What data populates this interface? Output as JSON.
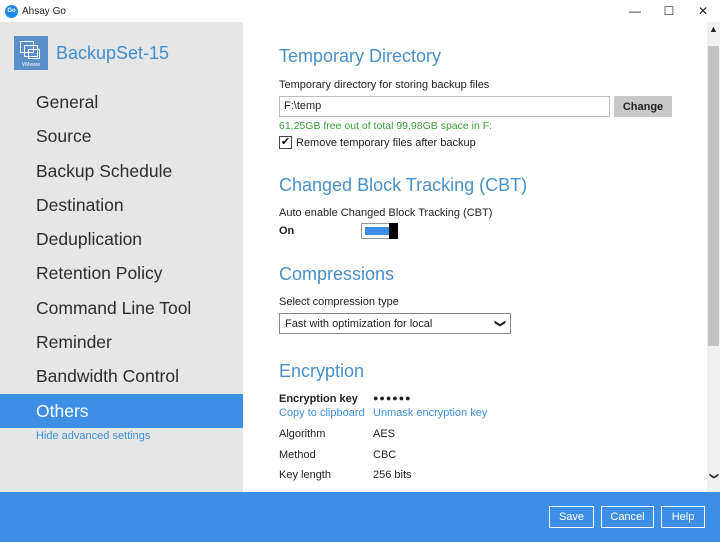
{
  "window": {
    "logo_text": "Go",
    "title": "Ahsay Go",
    "minimize": "—",
    "maximize": "☐",
    "close": "✕"
  },
  "sidebar": {
    "set_icon_label": "VMware",
    "set_name": "BackupSet-15",
    "items": [
      {
        "label": "General"
      },
      {
        "label": "Source"
      },
      {
        "label": "Backup Schedule"
      },
      {
        "label": "Destination"
      },
      {
        "label": "Deduplication"
      },
      {
        "label": "Retention Policy"
      },
      {
        "label": "Command Line Tool"
      },
      {
        "label": "Reminder"
      },
      {
        "label": "Bandwidth Control"
      },
      {
        "label": "Others"
      }
    ],
    "active_item": "Others",
    "hide_advanced": "Hide advanced settings"
  },
  "temp_dir": {
    "title": "Temporary Directory",
    "label": "Temporary directory for storing backup files",
    "value": "F:\\temp",
    "change_button": "Change",
    "space_info": "61.25GB free out of total 99.98GB space in F:",
    "remove_checked": true,
    "check_mark": "✔",
    "remove_label": "Remove temporary files after backup"
  },
  "cbt": {
    "title": "Changed Block Tracking (CBT)",
    "label": "Auto enable Changed Block Tracking (CBT)",
    "state": "On",
    "enabled": true
  },
  "compression": {
    "title": "Compressions",
    "label": "Select compression type",
    "selected": "Fast with optimization for local",
    "chevron": "❯"
  },
  "encryption": {
    "title": "Encryption",
    "key_label": "Encryption key",
    "key_value": "●●●●●●",
    "copy_link": "Copy to clipboard",
    "unmask_link": "Unmask encryption key",
    "algorithm_label": "Algorithm",
    "algorithm_value": "AES",
    "method_label": "Method",
    "method_value": "CBC",
    "key_length_label": "Key length",
    "key_length_value": "256 bits"
  },
  "scrollbar": {
    "up": "▲",
    "down": "❯"
  },
  "footer": {
    "save": "Save",
    "cancel": "Cancel",
    "help": "Help"
  },
  "colors": {
    "accent": "#3d8fe6",
    "heading": "#4a90c8",
    "success": "#3a9c3a",
    "sidebar_bg": "#e6e6e6"
  }
}
